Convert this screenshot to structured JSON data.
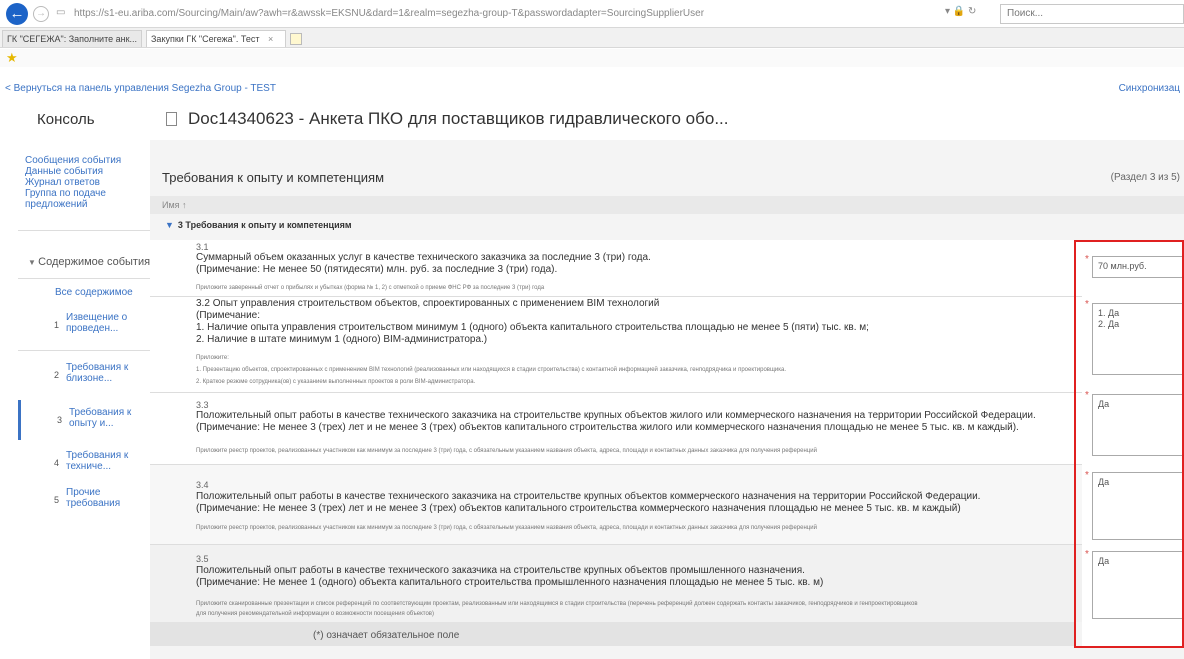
{
  "browser": {
    "url": "https://s1-eu.ariba.com/Sourcing/Main/aw?awh=r&awssk=EKSNU&dard=1&realm=segezha-group-T&passwordadapter=SourcingSupplierUser",
    "search_placeholder": "Поиск...",
    "tabs": [
      {
        "label": "ГК \"СЕГЕЖА\": Заполните анк..."
      },
      {
        "label": "Закупки ГК \"Сегежа\". Тест"
      }
    ]
  },
  "page": {
    "back_link": "< Вернуться на панель управления Segezha Group - TEST",
    "sync_link": "Синхронизац",
    "console_title": "Консоль",
    "doc_title": "Doc14340623 - Анкета ПКО для поставщиков гидравлического обо..."
  },
  "sidebar": {
    "links": [
      "Сообщения события",
      "Данные события",
      "Журнал ответов",
      "Группа по подаче",
      "предложений"
    ],
    "contents_header": "Содержимое события",
    "all_contents": "Все содержимое",
    "nav": [
      {
        "num": "1",
        "line1": "Извещение о",
        "line2": "проведен..."
      },
      {
        "num": "2",
        "line1": "Требования к",
        "line2": "близоне..."
      },
      {
        "num": "3",
        "line1": "Требования к",
        "line2": "опыту и..."
      },
      {
        "num": "4",
        "line1": "Требования к",
        "line2": "техниче..."
      },
      {
        "num": "5",
        "line1": "Прочие",
        "line2": "требования"
      }
    ]
  },
  "section": {
    "title": "Требования к опыту и компетенциям",
    "count": "(Раздел 3 из 5)",
    "name_header": "Имя ↑",
    "group": "3  Требования к опыту и компетенциям"
  },
  "questions": [
    {
      "num": "3.1",
      "text1": "Суммарный объем оказанных услуг в качестве технического заказчика за последние 3 (три) года.",
      "text2": "(Примечание: Не менее 50 (пятидесяти) млн. руб. за последние 3 (три) года).",
      "note1": "Приложите заверенный отчет о прибылях и убытках (форма № 1, 2) с отметкой о приеме ФНС РФ за последние 3 (три) года",
      "note2": "",
      "answer": "70 млн.руб."
    },
    {
      "num": "3.2",
      "text1": "Опыт управления строительством объектов, спроектированных с применением BIM технологий",
      "text2": "(Примечание:",
      "text3": "1. Наличие опыта управления строительством минимум 1 (одного) объекта капитального строительства площадью не менее 5 (пяти) тыс. кв. м;",
      "text4": "2. Наличие в штате минимум 1 (одного) BIM-администратора.)",
      "note0": "Приложите:",
      "note1": "1. Презентацию объектов, спроектированных с применением BIM технологий (реализованных или находящихся в стадии строительства) с контактной информацией заказчика, генподрядчика и проектировщика.",
      "note2": "2. Краткое резюме сотрудника(ов) с указанием выполненных проектов в роли BIM-администратора.",
      "answer": "1. Да\n2. Да"
    },
    {
      "num": "3.3",
      "text1": "Положительный опыт работы в качестве технического заказчика на  строительстве крупных объектов жилого или коммерческого назначения на территории Российской Федерации.",
      "text2": "(Примечание: Не менее 3 (трех) лет и не менее 3 (трех) объектов капитального строительства жилого или коммерческого назначения площадью не менее 5 тыс. кв. м каждый).",
      "note1": "Приложите реестр проектов, реализованных участником как минимум за последние 3 (три) года, с обязательным указанием названия объекта, адреса, площади и контактных данных заказчика для получения референций",
      "answer": "Да"
    },
    {
      "num": "3.4",
      "text1": "Положительный опыт работы в качестве технического заказчика на  строительстве крупных объектов коммерческого назначения на территории Российской Федерации.",
      "text2": "(Примечание: Не менее 3 (трех) лет и не менее 3 (трех) объектов капитального строительства коммерческого назначения площадью не менее 5 тыс. кв. м каждый)",
      "note1": "Приложите реестр проектов, реализованных участником как минимум за последние 3 (три) года, с обязательным указанием названия объекта, адреса, площади и контактных данных заказчика для получения референций",
      "answer": "Да"
    },
    {
      "num": "3.5",
      "text1": "Положительный опыт работы в качестве технического заказчика на  строительстве крупных объектов промышленного назначения.",
      "text2": "(Примечание: Не менее 1 (одного) объекта капитального строительства промышленного назначения площадью не менее 5 тыс. кв. м)",
      "note1": "Приложите сканированные презентации и список референций по соответствующим проектам, реализованным или находящимся в стадии строительства (перечень референций должен содержать контакты заказчиков, генподрядчиков и генпроектировщиков",
      "note2": "для получения рекомендательной информации о возможности посещения объектов)",
      "answer": "Да"
    }
  ],
  "required_note": "(*) означает обязательное поле",
  "colors": {
    "link": "#3b73c4",
    "required": "#d9534f",
    "highlight": "#e02020"
  }
}
